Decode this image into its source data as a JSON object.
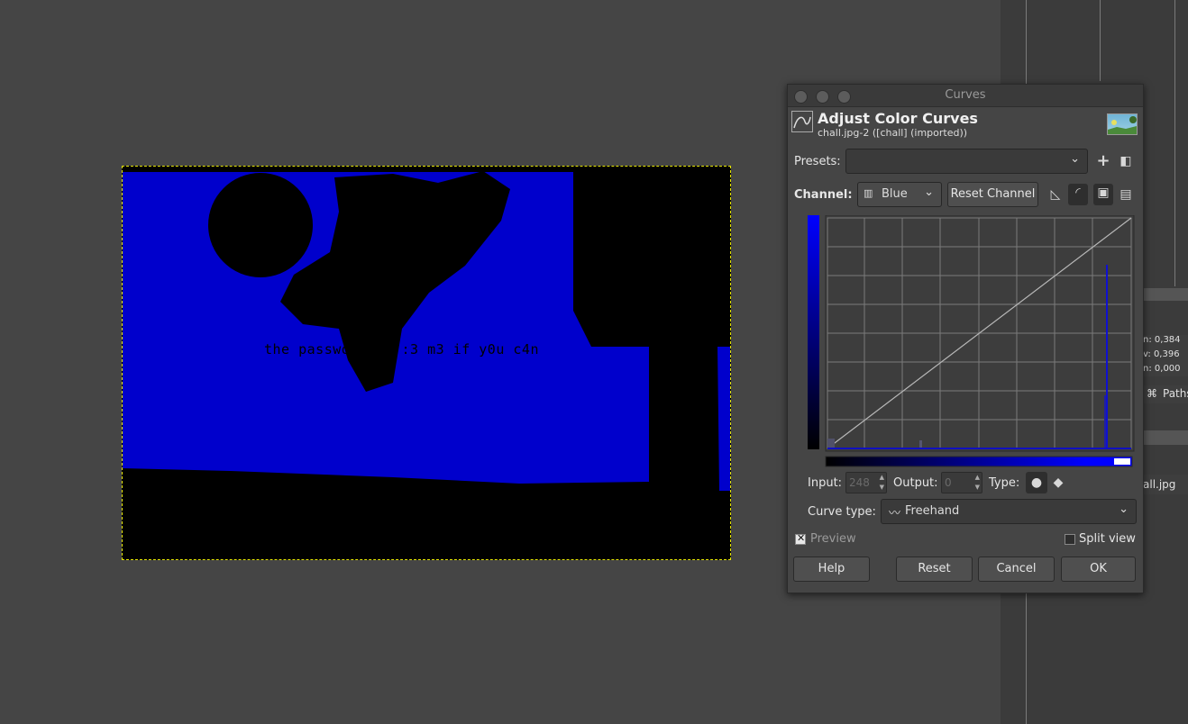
{
  "canvas": {
    "image_text": "the password is :3 m3 if y0u c4n"
  },
  "dock": {
    "values": [
      "0,384",
      "0,396",
      "0,000"
    ],
    "value_prefixes": [
      "n:",
      "v:",
      "n:"
    ],
    "paths_tab": "Paths",
    "image_label": "all.jpg"
  },
  "dialog": {
    "window_title": "Curves",
    "heading": "Adjust Color Curves",
    "subheading": "chall.jpg-2 ([chall] (imported))",
    "presets_label": "Presets:",
    "presets_value": "",
    "channel_label": "Channel:",
    "channel_value": "Blue",
    "reset_channel": "Reset Channel",
    "input_label": "Input:",
    "input_value": "248",
    "output_label": "Output:",
    "output_value": "0",
    "type_label": "Type:",
    "curve_type_label": "Curve type:",
    "curve_type_value": "Freehand",
    "preview_label": "Preview",
    "preview_checked": true,
    "split_view_label": "Split view",
    "split_view_checked": false,
    "buttons": {
      "help": "Help",
      "reset": "Reset",
      "cancel": "Cancel",
      "ok": "OK"
    },
    "colors": {
      "channel": "#0000ff",
      "image_blue": "#0000cc"
    }
  }
}
